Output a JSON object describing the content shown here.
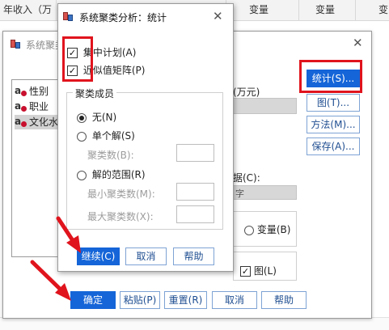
{
  "sheet": {
    "headers": [
      "年收入（万",
      "",
      "变量",
      "变量",
      "变"
    ]
  },
  "main_dialog": {
    "title": "系统聚类",
    "variables": [
      {
        "label": "性别",
        "selected": false
      },
      {
        "label": "职业",
        "selected": false
      },
      {
        "label": "文化水",
        "selected": true
      }
    ],
    "variables_box_label": "(万元)",
    "label_cases_by_label": "据(C):",
    "label_field_fragment": "字",
    "cluster_radio_variable": "变量(B)",
    "display_chart_label": "图(L)",
    "side_buttons": {
      "statistics": "统计(S)...",
      "plots": "图(T)...",
      "method": "方法(M)...",
      "save": "保存(A)..."
    },
    "bottom_buttons": {
      "ok": "确定",
      "paste": "粘贴(P)",
      "reset": "重置(R)",
      "cancel": "取消",
      "help": "帮助"
    }
  },
  "sub_dialog": {
    "title": "系统聚类分析：统计",
    "agglomeration_schedule": {
      "label": "集中计划(A)",
      "checked": true
    },
    "proximity_matrix": {
      "label": "近似值矩阵(P)",
      "checked": true
    },
    "group_title": "聚类成员",
    "radio_none": {
      "label": "无(N)",
      "selected": true
    },
    "radio_single": {
      "label": "单个解(S)",
      "selected": false
    },
    "num_clusters_label": "聚类数(B):",
    "radio_range": {
      "label": "解的范围(R)",
      "selected": false
    },
    "min_clusters_label": "最小聚类数(M):",
    "max_clusters_label": "最大聚类数(X):",
    "buttons": {
      "continue": "继续(C)",
      "cancel": "取消",
      "help": "帮助"
    }
  },
  "colors": {
    "highlight_red": "#e0141d",
    "primary_blue": "#1565d8",
    "button_text_blue": "#1f4e91"
  }
}
